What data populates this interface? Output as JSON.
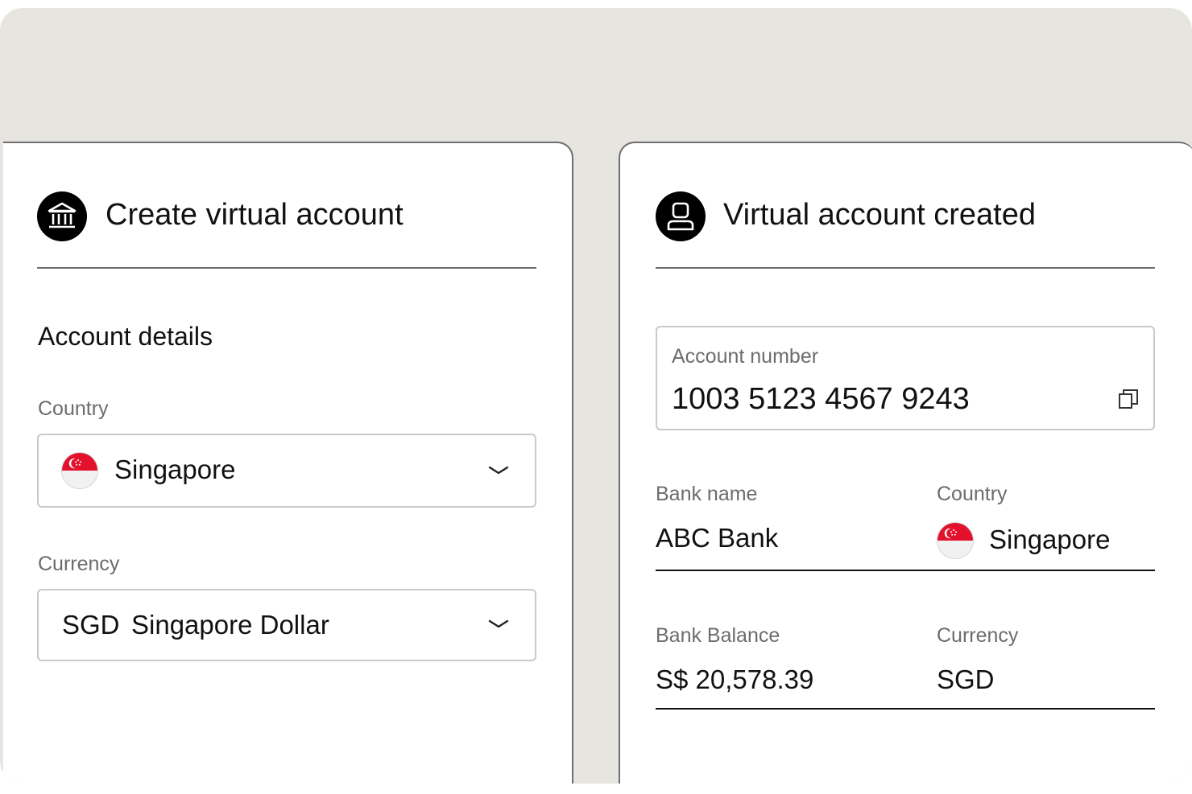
{
  "create_panel": {
    "title": "Create virtual account",
    "icon": "bank-icon",
    "section_heading": "Account details",
    "country": {
      "label": "Country",
      "value": "Singapore",
      "flag": "singapore-flag-icon"
    },
    "currency": {
      "label": "Currency",
      "code": "SGD",
      "name": "Singapore Dollar"
    }
  },
  "created_panel": {
    "title": "Virtual account created",
    "icon": "user-icon",
    "account_number": {
      "label": "Account number",
      "value": "1003 5123 4567 9243",
      "copy_icon": "copy-icon"
    },
    "bank_name": {
      "label": "Bank name",
      "value": "ABC Bank"
    },
    "country": {
      "label": "Country",
      "value": "Singapore",
      "flag": "singapore-flag-icon"
    },
    "bank_balance": {
      "label": "Bank Balance",
      "value": "S$ 20,578.39"
    },
    "currency": {
      "label": "Currency",
      "value": "SGD"
    }
  },
  "colors": {
    "background": "#e6e5df",
    "flag_red": "#e3112b",
    "flag_white": "#f1f1f1"
  }
}
